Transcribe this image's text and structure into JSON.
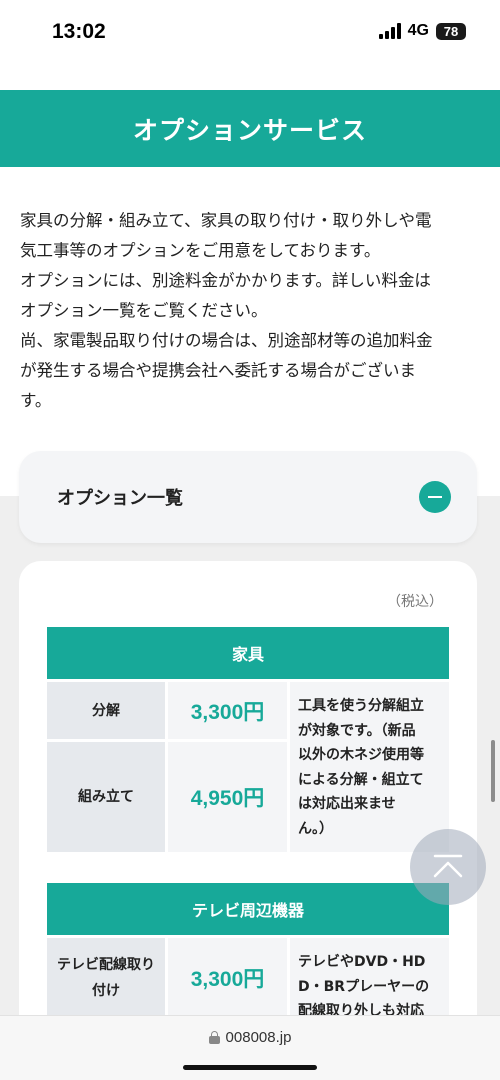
{
  "status": {
    "time": "13:02",
    "network": "4G",
    "battery": "78"
  },
  "header": {
    "title": "オプションサービス"
  },
  "intro": {
    "lines": [
      "家具の分解・組み立て、家具の取り付け・取り外しや電",
      "気工事等のオプションをご用意をしております。",
      "オプションには、別途料金がかかります。詳しい料金は",
      "オプション一覧をご覧ください。",
      "尚、家電製品取り付けの場合は、別途部材等の追加料金",
      "が発生する場合や提携会社へ委託する場合がございま",
      "す。"
    ]
  },
  "accordion": {
    "title": "オプション一覧"
  },
  "card": {
    "tax_note": "（税込）",
    "tables": [
      {
        "category": "家具",
        "rows": [
          {
            "name": "分解",
            "price": "3,300円"
          },
          {
            "name": "組み立て",
            "price": "4,950円"
          }
        ],
        "desc_lines": [
          "工具を使う分解組立",
          "が対象です。（新品",
          "以外の木ネジ使用等",
          "による分解・組立て",
          "は対応出来ませ",
          "ん。）"
        ]
      },
      {
        "category": "テレビ周辺機器",
        "rows": [
          {
            "name": "テレビ配線取り付け",
            "price": "3,300円"
          }
        ],
        "desc_lines": [
          "テレビやDVD・HD",
          "D・BRプレーヤーの",
          "配線取り外しも対応"
        ]
      }
    ]
  },
  "browser": {
    "url": "008008.jp"
  },
  "icons": {
    "scroll_top": "arrow-up-icon",
    "accordion_toggle": "minus-icon"
  },
  "colors": {
    "accent": "#17a999"
  }
}
